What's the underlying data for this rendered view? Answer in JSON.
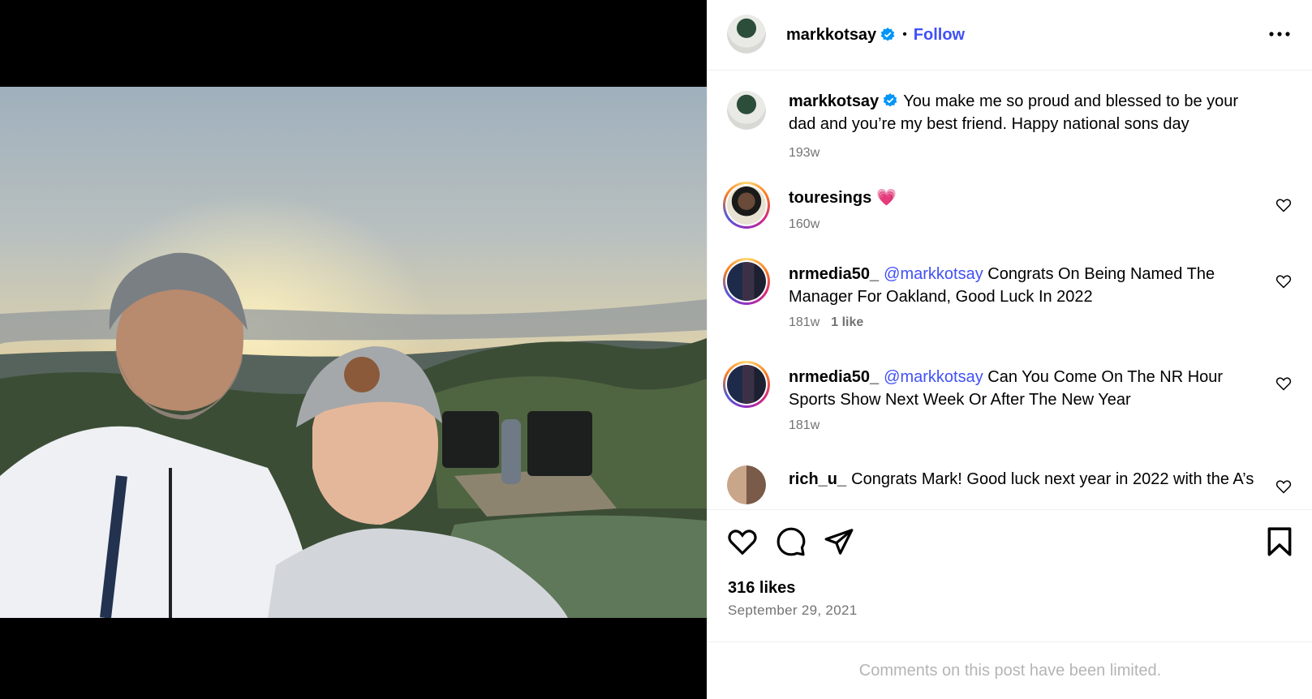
{
  "post": {
    "author": "markkotsay",
    "follow_label": "Follow",
    "separator": "•",
    "caption_user": "markkotsay",
    "caption_text": "You make me so proud and blessed to be your dad and you’re my best friend. Happy national sons day",
    "caption_age": "193w",
    "likes": "316 likes",
    "date": "September 29, 2021",
    "limited_notice": "Comments on this post have been limited."
  },
  "comments": [
    {
      "user": "touresings",
      "text": "💗",
      "age": "160w",
      "likes": ""
    },
    {
      "user": "nrmedia50_",
      "mention": "@markkotsay",
      "text": " Congrats On Being Named The Manager For Oakland, Good Luck In 2022",
      "age": "181w",
      "likes": "1 like"
    },
    {
      "user": "nrmedia50_",
      "mention": "@markkotsay",
      "text": " Can You Come On The NR Hour Sports Show Next Week Or After The New Year",
      "age": "181w",
      "likes": ""
    },
    {
      "user": "rich_u_",
      "text": "Congrats Mark! Good luck next year in 2022 with the A’s",
      "age": "",
      "likes": ""
    }
  ],
  "icons": {
    "verified": "verified-badge-icon",
    "more": "more-options-icon",
    "like": "heart-icon",
    "comment": "comment-icon",
    "share": "share-icon",
    "save": "bookmark-icon"
  },
  "colors": {
    "link": "#4150f7",
    "verified": "#0095f6",
    "muted": "#737373"
  }
}
